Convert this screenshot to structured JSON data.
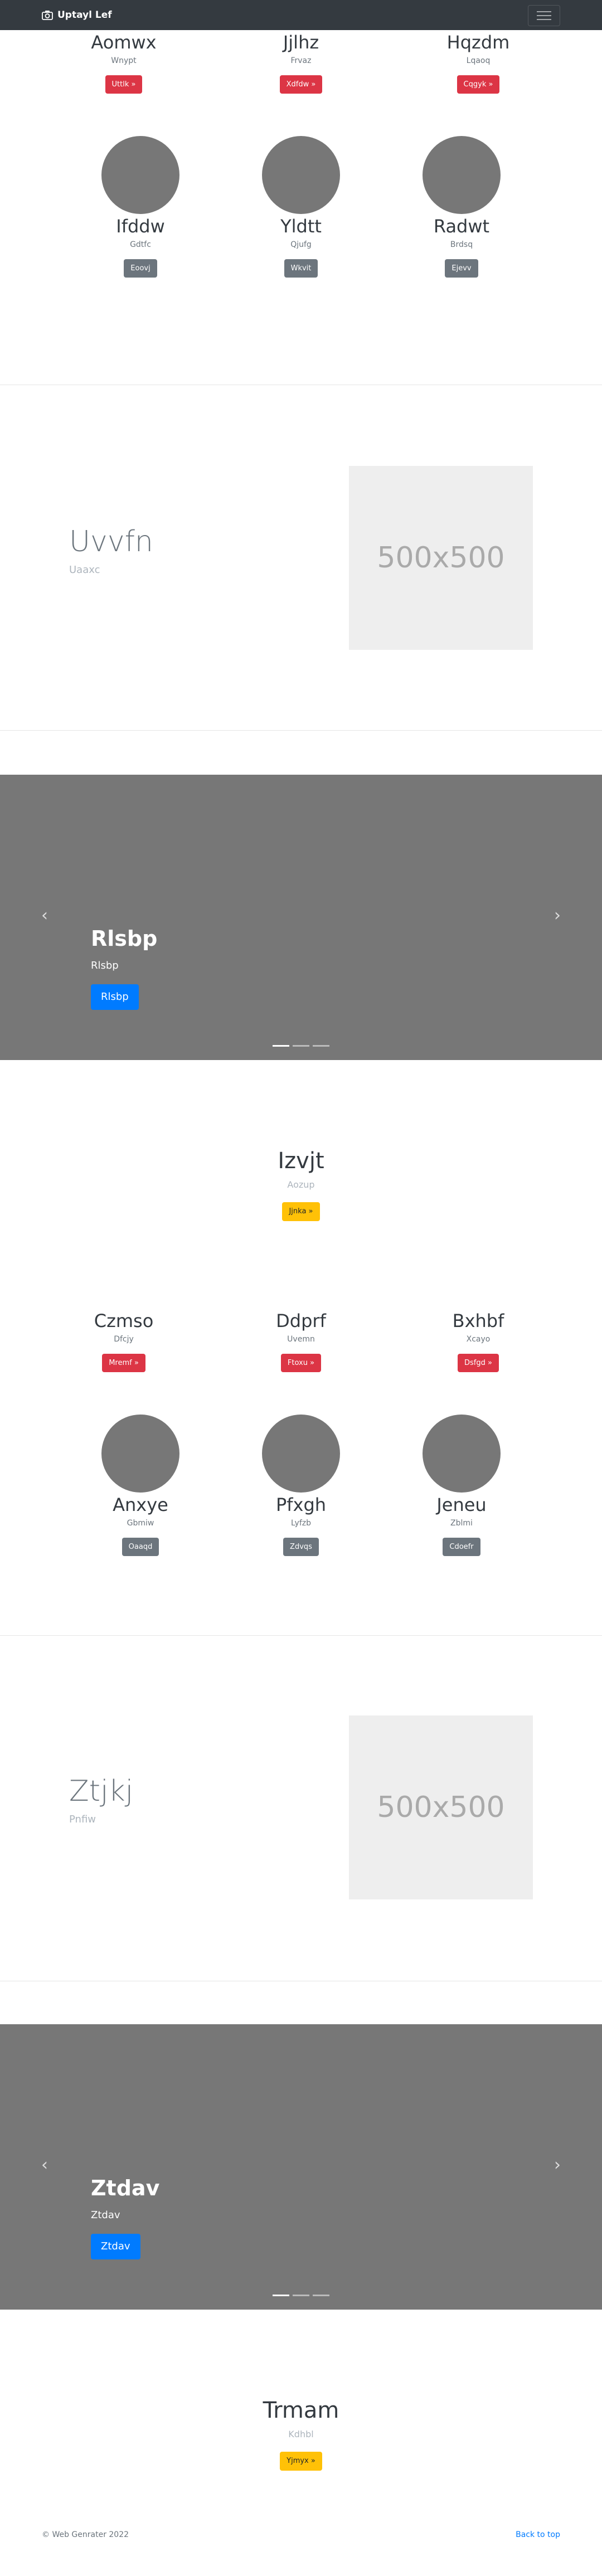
{
  "navbar": {
    "brand": "Uptayl Lef",
    "camera_icon": "camera-icon",
    "menu_icon": "hamburger-icon"
  },
  "top_grid": {
    "row1": [
      {
        "name": "Aomwx",
        "sub": "Wnypt",
        "button": "Uttlk »"
      },
      {
        "name": "Jjlhz",
        "sub": "Frvaz",
        "button": "Xdfdw »"
      },
      {
        "name": "Hqzdm",
        "sub": "Lqaoq",
        "button": "Cqgyk »"
      }
    ],
    "row2": [
      {
        "name": "Ifddw",
        "sub": "Gdtfc",
        "button": "Eoovj"
      },
      {
        "name": "Yldtt",
        "sub": "Qjufg",
        "button": "Wkvit"
      },
      {
        "name": "Radwt",
        "sub": "Brdsq",
        "button": "Ejevv"
      }
    ]
  },
  "feature1": {
    "title": "Uvvfn",
    "subtitle": "Uaaxc",
    "placeholder": "500x500"
  },
  "carousel1": {
    "title": "Rlsbp",
    "subtitle": "Rlsbp",
    "button": "Rlsbp",
    "prev": "‹",
    "next": "›"
  },
  "heading1": {
    "title": "Izvjt",
    "subtitle": "Aozup",
    "button": "Jjnka »"
  },
  "mid_grid": {
    "row1": [
      {
        "name": "Czmso",
        "sub": "Dfcjy",
        "button": "Mremf »"
      },
      {
        "name": "Ddprf",
        "sub": "Uvemn",
        "button": "Ftoxu »"
      },
      {
        "name": "Bxhbf",
        "sub": "Xcayo",
        "button": "Dsfgd »"
      }
    ],
    "row2": [
      {
        "name": "Anxye",
        "sub": "Gbmiw",
        "button": "Oaaqd"
      },
      {
        "name": "Pfxgh",
        "sub": "Lyfzb",
        "button": "Zdvqs"
      },
      {
        "name": "Jeneu",
        "sub": "Zblmi",
        "button": "Cdoefr"
      }
    ]
  },
  "feature2": {
    "title": "Ztjkj",
    "subtitle": "Pnfiw",
    "placeholder": "500x500"
  },
  "carousel2": {
    "title": "Ztdav",
    "subtitle": "Ztdav",
    "button": "Ztdav",
    "prev": "‹",
    "next": "›"
  },
  "heading2": {
    "title": "Trmam",
    "subtitle": "Kdhbl",
    "button": "Yjmyx »"
  },
  "footer": {
    "copyright": "© Web Genrater 2022",
    "back_to_top": "Back to top"
  }
}
